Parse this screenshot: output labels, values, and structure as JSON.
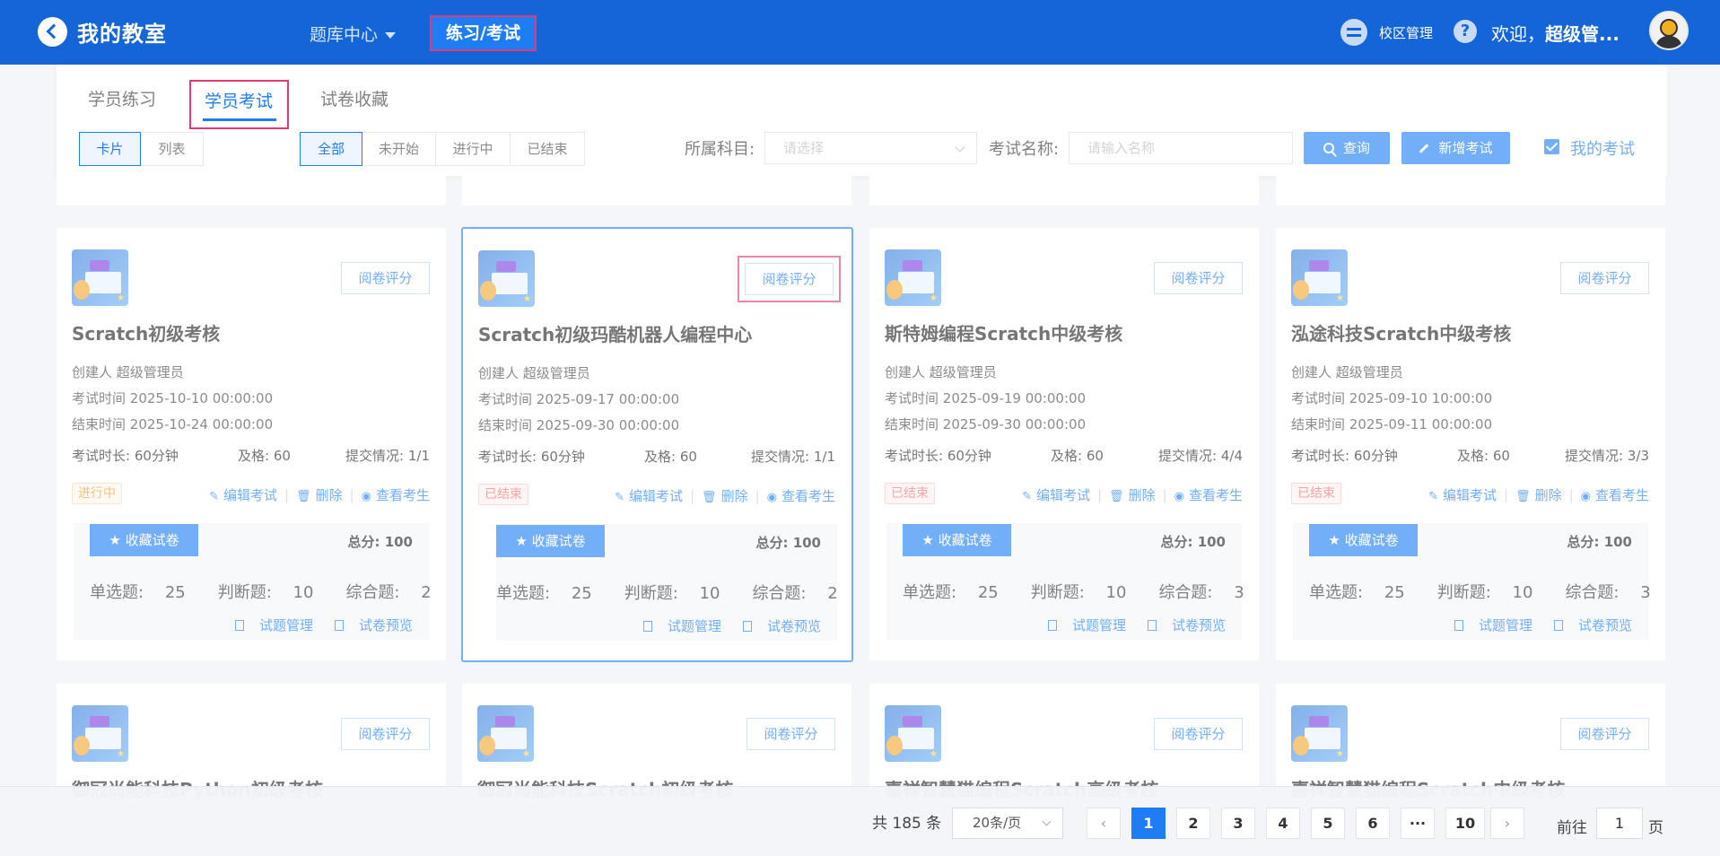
{
  "header": {
    "title": "我的教室",
    "menu_bank": "题库中心",
    "menu_exam": "练习/考试",
    "campus": "校区管理",
    "welcome_prefix": "欢迎，",
    "welcome_user": "超级管...",
    "help": "?"
  },
  "tabs": [
    "学员练习",
    "学员考试",
    "试卷收藏"
  ],
  "view_toggle": [
    "卡片",
    "列表"
  ],
  "status_filter": [
    "全部",
    "未开始",
    "进行中",
    "已结束"
  ],
  "filters": {
    "subject_label": "所属科目:",
    "subject_placeholder": "请选择",
    "name_label": "考试名称:",
    "name_placeholder": "请输入名称",
    "query_button": "查询",
    "add_button": "新增考试",
    "my_exams": "我的考试"
  },
  "card_labels": {
    "grade": "阅卷评分",
    "creator": "创建人",
    "exam_time": "考试时间",
    "end_time": "结束时间",
    "duration": "考试时长:",
    "pass": "及格:",
    "submit": "提交情况:",
    "edit": "编辑考试",
    "delete": "删除",
    "view": "查看考生",
    "favorite": "收藏试卷",
    "total": "总分:",
    "single": "单选题:",
    "judge": "判断题:",
    "comprehensive": "综合题:",
    "manage": "试题管理",
    "preview": "试卷预览"
  },
  "cards": [
    {
      "title": "Scratch初级考核",
      "creator": "超级管理员",
      "exam_time": "2025-10-10 00:00:00",
      "end_time": "2025-10-24 00:00:00",
      "duration": "60分钟",
      "pass": "60",
      "submit": "1/1",
      "status": "进行中",
      "total": "100",
      "single": "25",
      "judge": "10",
      "comprehensive": "2"
    },
    {
      "title": "Scratch初级玛酷机器人编程中心",
      "creator": "超级管理员",
      "exam_time": "2025-09-17 00:00:00",
      "end_time": "2025-09-30 00:00:00",
      "duration": "60分钟",
      "pass": "60",
      "submit": "1/1",
      "status": "已结束",
      "total": "100",
      "single": "25",
      "judge": "10",
      "comprehensive": "2"
    },
    {
      "title": "斯特姆编程Scratch中级考核",
      "creator": "超级管理员",
      "exam_time": "2025-09-19 00:00:00",
      "end_time": "2025-09-30 00:00:00",
      "duration": "60分钟",
      "pass": "60",
      "submit": "4/4",
      "status": "已结束",
      "total": "100",
      "single": "25",
      "judge": "10",
      "comprehensive": "3"
    },
    {
      "title": "泓途科技Scratch中级考核",
      "creator": "超级管理员",
      "exam_time": "2025-09-10 10:00:00",
      "end_time": "2025-09-11 00:00:00",
      "duration": "60分钟",
      "pass": "60",
      "submit": "3/3",
      "status": "已结束",
      "total": "100",
      "single": "25",
      "judge": "10",
      "comprehensive": "3"
    }
  ],
  "cards_row2": [
    {
      "title": "御冠尚能科技Python初级考核"
    },
    {
      "title": "御冠尚能科技Scratch初级考核"
    },
    {
      "title": "嘉祥智慧猫编程Scratch高级考核"
    },
    {
      "title": "嘉祥智慧猫编程Scratch中级考核"
    }
  ],
  "pagination": {
    "total": "共 185 条",
    "page_size": "20条/页",
    "prev": "‹",
    "next": "›",
    "pages": [
      "1",
      "2",
      "3",
      "4",
      "5",
      "6",
      "···",
      "10"
    ],
    "goto_label": "前往",
    "goto_value": "1",
    "goto_suffix": "页"
  },
  "colors": {
    "header": "#1466d8",
    "primary": "#1e7cf5",
    "highlight": "#e23a73",
    "running": "#e6a23c",
    "ended": "#f56c6c"
  }
}
